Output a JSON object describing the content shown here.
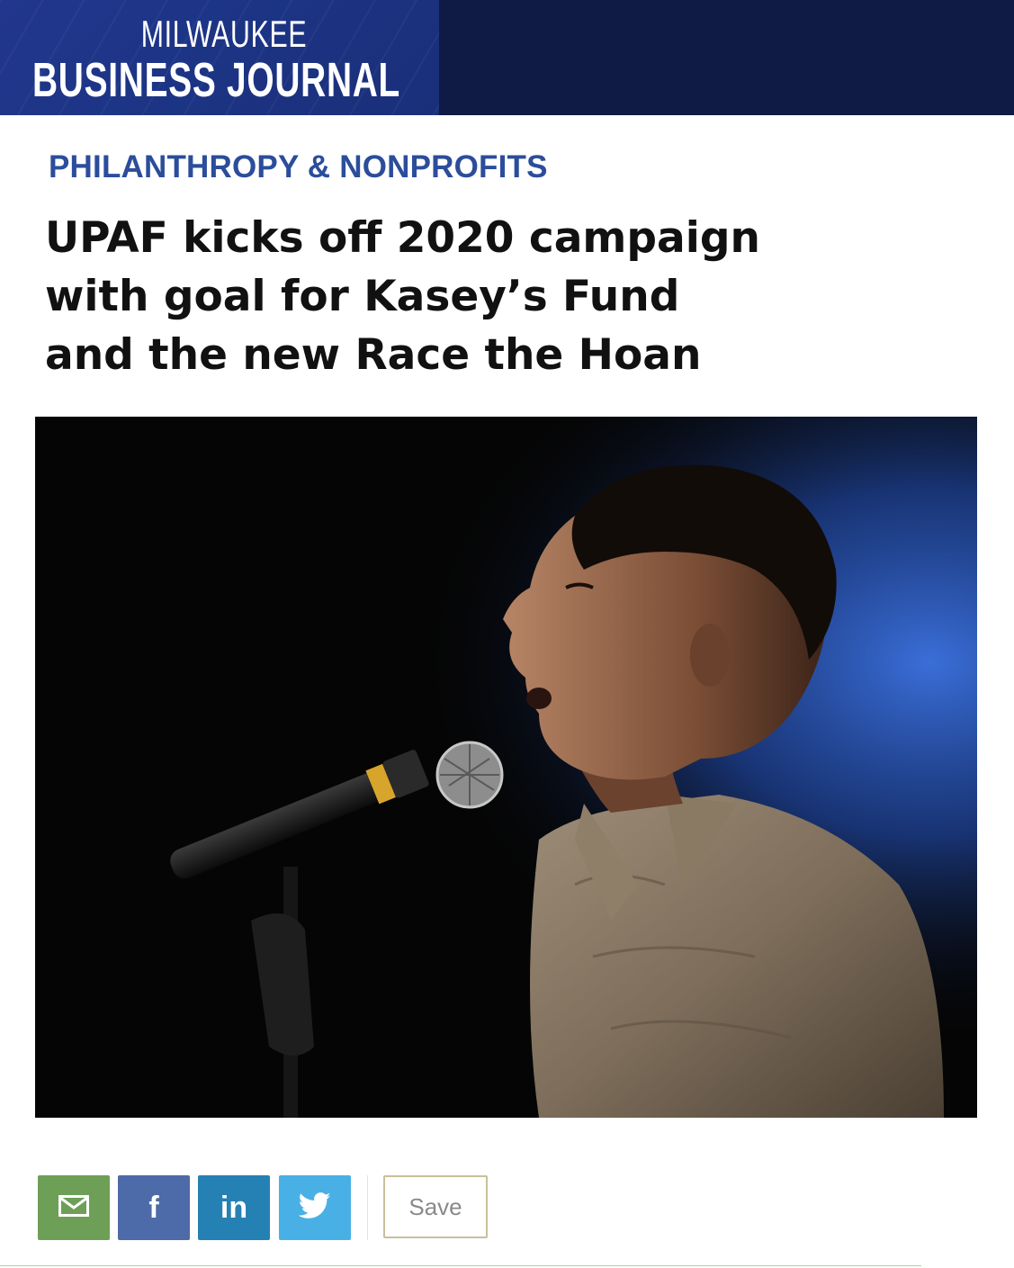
{
  "masthead": {
    "line1": "MILWAUKEE",
    "line2": "BUSINESS JOURNAL"
  },
  "article": {
    "kicker": "PHILANTHROPY & NONPROFITS",
    "headline_lines": [
      "UPAF kicks off 2020 campaign",
      "with goal for Kasey’s Fund",
      "and the new Race the Hoan"
    ]
  },
  "share": {
    "email_icon": "envelope-icon",
    "facebook_label": "f",
    "linkedin_label": "in",
    "twitter_icon": "bird-icon",
    "save_label": "Save"
  },
  "colors": {
    "masthead_bg": "#0f1a45",
    "logo_bg": "#1d3586",
    "kicker": "#2b4d9b",
    "email": "#6e9f56",
    "facebook": "#4d6aa9",
    "linkedin": "#2580b3",
    "twitter": "#49b0e6"
  }
}
